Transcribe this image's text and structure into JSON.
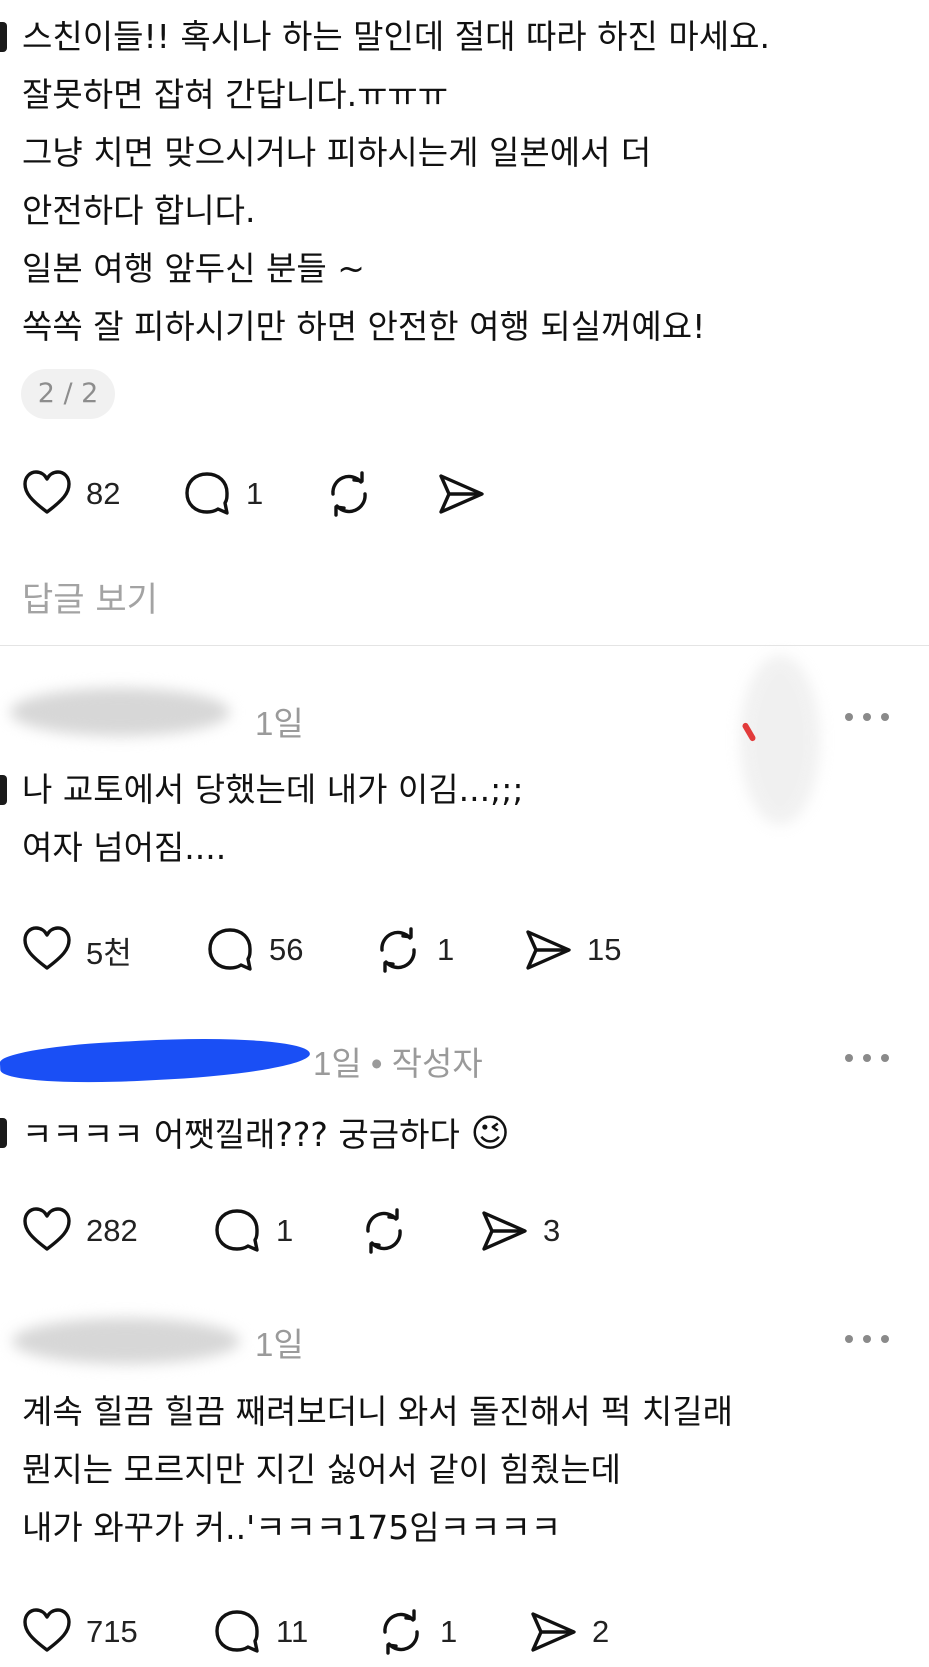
{
  "post": {
    "lines": [
      "스친이들!! 혹시나 하는 말인데  절대 따라 하진 마세요.",
      "잘못하면 잡혀 간답니다.ㅠㅠㅠ",
      "그냥 치면 맞으시거나 피하시는게 일본에서  더",
      "안전하다 합니다.",
      "일본 여행 앞두신 분들 ~",
      "쏙쏙 잘 피하시기만 하면  안전한 여행  되실꺼예요!"
    ],
    "page_indicator": "2 / 2",
    "likes": "82",
    "comments": "1",
    "view_replies": "답글 보기"
  },
  "replies": [
    {
      "time": "1일",
      "lines": [
        "나 교토에서 당했는데 내가 이김...;;;",
        "여자 넘어짐...."
      ],
      "likes": "5천",
      "comments": "56",
      "reposts": "1",
      "shares": "15"
    },
    {
      "time": "1일",
      "author_tag": "• 작성자",
      "text": "ㅋㅋㅋㅋ 어쨋낄래??? 궁금하다",
      "emoji": "😉",
      "likes": "282",
      "comments": "1",
      "shares": "3"
    },
    {
      "time": "1일",
      "lines": [
        "계속 힐끔 힐끔 째려보더니 와서 돌진해서 퍽 치길래",
        "뭔지는 모르지만 지긴 싫어서 같이 힘줬는데",
        "내가 와꾸가 커..'ㅋㅋㅋ175임ㅋㅋㅋㅋ"
      ],
      "likes": "715",
      "comments": "11",
      "reposts": "1",
      "shares": "2"
    }
  ],
  "colors": {
    "text": "#111111",
    "muted": "#9a9a9a",
    "redaction_blue": "#1a4ff5"
  },
  "icons": [
    "heart-icon",
    "comment-icon",
    "repost-icon",
    "share-icon",
    "more-icon"
  ]
}
